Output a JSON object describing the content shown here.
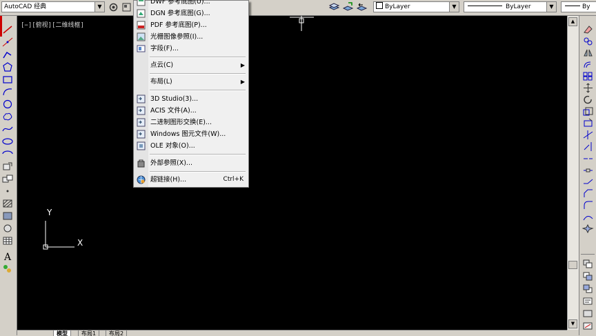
{
  "toolbar": {
    "workspace": "AutoCAD 经典",
    "color": "ByLayer",
    "linetype": "ByLayer",
    "lineweight": "By"
  },
  "viewport": {
    "control_label": "[−][俯视][二维线框]",
    "ucs_x": "X",
    "ucs_y": "Y"
  },
  "menu": {
    "items": [
      {
        "label": "DWF 参考底图(U)...",
        "icon": "dwf-underlay-icon"
      },
      {
        "label": "DGN 参考底图(G)...",
        "icon": "dgn-underlay-icon"
      },
      {
        "label": "PDF 参考底图(P)...",
        "icon": "pdf-underlay-icon"
      },
      {
        "label": "光栅图像参照(I)...",
        "icon": "raster-image-icon"
      },
      {
        "label": "字段(F)...",
        "icon": "field-icon"
      },
      {
        "label": "点云(C)",
        "submenu": true
      },
      {
        "label": "布局(L)",
        "submenu": true
      },
      {
        "label": "3D Studio(3)...",
        "icon": "3ds-import-icon"
      },
      {
        "label": "ACIS 文件(A)...",
        "icon": "acis-import-icon"
      },
      {
        "label": "二进制图形交换(E)...",
        "icon": "dxb-import-icon"
      },
      {
        "label": "Windows 图元文件(W)...",
        "icon": "wmf-import-icon"
      },
      {
        "label": "OLE 对象(O)...",
        "icon": "ole-object-icon"
      },
      {
        "label": "外部参照(X)...",
        "icon": "xref-icon"
      },
      {
        "label": "超链接(H)...",
        "shortcut": "Ctrl+K",
        "icon": "hyperlink-icon"
      }
    ]
  },
  "tabs": [
    "模型",
    "布局1",
    "布局2"
  ],
  "colors": {
    "canvas": "#000000",
    "chrome": "#d4d0c8",
    "menu_bg": "#f0f0f0",
    "accent_red": "#cc0000"
  }
}
